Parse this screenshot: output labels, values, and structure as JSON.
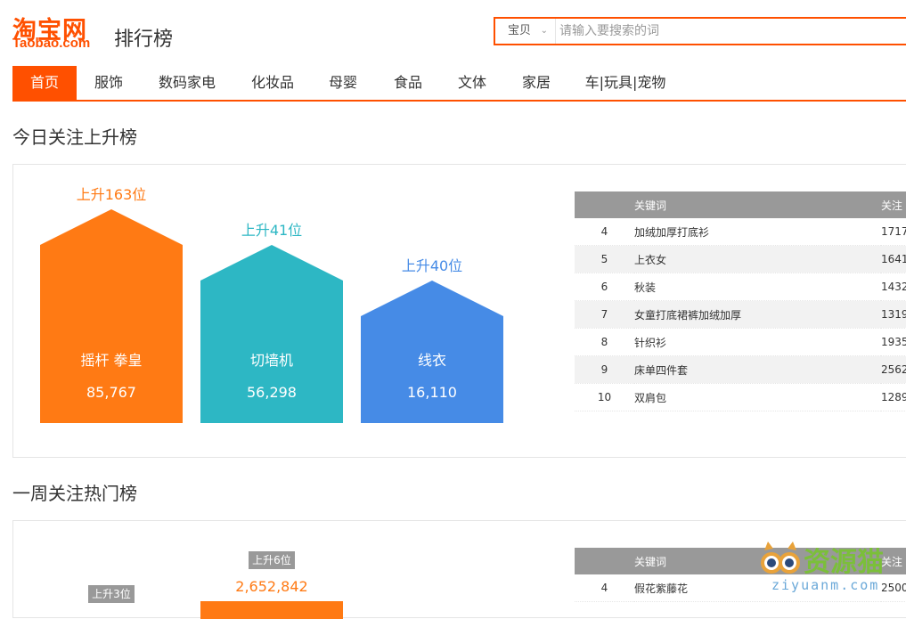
{
  "header": {
    "logo_cn": "淘宝网",
    "logo_en": "Taobao.com",
    "page_title": "排行榜",
    "search": {
      "category": "宝贝",
      "placeholder": "请输入要搜索的词"
    }
  },
  "nav": {
    "items": [
      {
        "label": "首页",
        "active": true
      },
      {
        "label": "服饰"
      },
      {
        "label": "数码家电"
      },
      {
        "label": "化妆品"
      },
      {
        "label": "母婴"
      },
      {
        "label": "食品"
      },
      {
        "label": "文体"
      },
      {
        "label": "家居"
      },
      {
        "label": "车|玩具|宠物"
      }
    ]
  },
  "today": {
    "title": "今日关注上升榜",
    "top3": [
      {
        "rise": "上升163位",
        "name": "摇杆 拳皇",
        "value": "85,767",
        "color": "#ff7a14"
      },
      {
        "rise": "上升41位",
        "name": "切墙机",
        "value": "56,298",
        "color": "#2db7c4"
      },
      {
        "rise": "上升40位",
        "name": "线衣",
        "value": "16,110",
        "color": "#468be6"
      }
    ],
    "table": {
      "headers": [
        "",
        "关键词",
        "关注"
      ],
      "rows": [
        {
          "rank": "4",
          "keyword": "加绒加厚打底衫",
          "value": "1717"
        },
        {
          "rank": "5",
          "keyword": "上衣女",
          "value": "1641"
        },
        {
          "rank": "6",
          "keyword": "秋装",
          "value": "1432"
        },
        {
          "rank": "7",
          "keyword": "女童打底裙裤加绒加厚",
          "value": "1319"
        },
        {
          "rank": "8",
          "keyword": "针织衫",
          "value": "1935"
        },
        {
          "rank": "9",
          "keyword": "床单四件套",
          "value": "2562"
        },
        {
          "rank": "10",
          "keyword": "双肩包",
          "value": "1289"
        }
      ]
    }
  },
  "week": {
    "title": "一周关注热门榜",
    "badge_center": "上升6位",
    "value_center": "2,652,842",
    "badge_left": "上升3位",
    "table": {
      "headers": [
        "",
        "关键词",
        "关注"
      ],
      "rows": [
        {
          "rank": "4",
          "keyword": "假花紫藤花",
          "value": "2500"
        }
      ]
    }
  },
  "watermark": {
    "text_cn": "资源猫",
    "text_en": "ziyuanm.com"
  }
}
